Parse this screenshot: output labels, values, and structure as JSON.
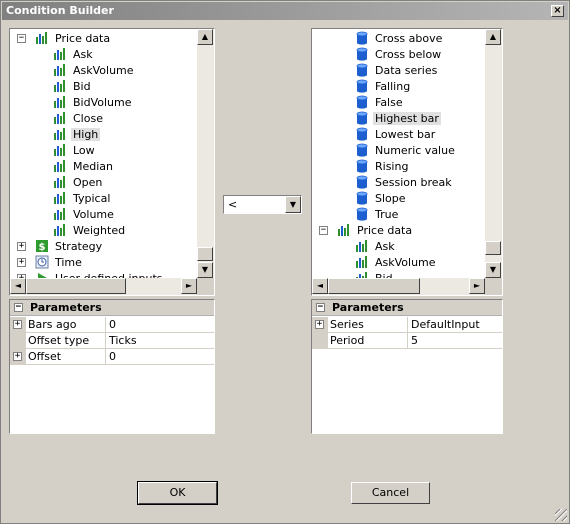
{
  "window": {
    "title": "Condition Builder",
    "close_glyph": "×"
  },
  "left_tree": {
    "items": [
      {
        "label": "Price data",
        "icon": "chart-icon",
        "expander": "−",
        "level": 0
      },
      {
        "label": "Ask",
        "icon": "chart-icon",
        "level": 1
      },
      {
        "label": "AskVolume",
        "icon": "chart-icon",
        "level": 1
      },
      {
        "label": "Bid",
        "icon": "chart-icon",
        "level": 1
      },
      {
        "label": "BidVolume",
        "icon": "chart-icon",
        "level": 1
      },
      {
        "label": "Close",
        "icon": "chart-icon",
        "level": 1
      },
      {
        "label": "High",
        "icon": "chart-icon",
        "level": 1,
        "selected": true
      },
      {
        "label": "Low",
        "icon": "chart-icon",
        "level": 1
      },
      {
        "label": "Median",
        "icon": "chart-icon",
        "level": 1
      },
      {
        "label": "Open",
        "icon": "chart-icon",
        "level": 1
      },
      {
        "label": "Typical",
        "icon": "chart-icon",
        "level": 1
      },
      {
        "label": "Volume",
        "icon": "chart-icon",
        "level": 1
      },
      {
        "label": "Weighted",
        "icon": "chart-icon",
        "level": 1
      },
      {
        "label": "Strategy",
        "icon": "dollar-icon",
        "expander": "+",
        "level": 0
      },
      {
        "label": "Time",
        "icon": "clock-icon",
        "expander": "+",
        "level": 0
      },
      {
        "label": "User defined inputs",
        "icon": "play-icon",
        "expander": "+",
        "level": 0
      }
    ]
  },
  "right_tree": {
    "items": [
      {
        "label": "Cross above",
        "icon": "cylinder-icon",
        "level": 1
      },
      {
        "label": "Cross below",
        "icon": "cylinder-icon",
        "level": 1
      },
      {
        "label": "Data series",
        "icon": "cylinder-icon",
        "level": 1
      },
      {
        "label": "Falling",
        "icon": "cylinder-icon",
        "level": 1
      },
      {
        "label": "False",
        "icon": "cylinder-icon",
        "level": 1
      },
      {
        "label": "Highest bar",
        "icon": "cylinder-icon",
        "level": 1,
        "selected": true
      },
      {
        "label": "Lowest bar",
        "icon": "cylinder-icon",
        "level": 1
      },
      {
        "label": "Numeric value",
        "icon": "cylinder-icon",
        "level": 1
      },
      {
        "label": "Rising",
        "icon": "cylinder-icon",
        "level": 1
      },
      {
        "label": "Session break",
        "icon": "cylinder-icon",
        "level": 1
      },
      {
        "label": "Slope",
        "icon": "cylinder-icon",
        "level": 1
      },
      {
        "label": "True",
        "icon": "cylinder-icon",
        "level": 1
      },
      {
        "label": "Price data",
        "icon": "chart-icon",
        "expander": "−",
        "level": 0
      },
      {
        "label": "Ask",
        "icon": "chart-icon",
        "level": 1
      },
      {
        "label": "AskVolume",
        "icon": "chart-icon",
        "level": 1
      },
      {
        "label": "Bid",
        "icon": "chart-icon",
        "level": 1
      }
    ]
  },
  "operator": {
    "value": "<"
  },
  "left_params": {
    "header": "Parameters",
    "rows": [
      {
        "name": "Bars ago",
        "value": "0",
        "expander": "+"
      },
      {
        "name": "Offset type",
        "value": "Ticks",
        "expander": ""
      },
      {
        "name": "Offset",
        "value": "0",
        "expander": "+"
      }
    ]
  },
  "right_params": {
    "header": "Parameters",
    "rows": [
      {
        "name": "Series",
        "value": "DefaultInput",
        "expander": "+"
      },
      {
        "name": "Period",
        "value": "5",
        "expander": ""
      }
    ]
  },
  "buttons": {
    "ok_label": "OK",
    "cancel_label": "Cancel"
  },
  "scroll_glyphs": {
    "up": "▲",
    "down": "▼",
    "left": "◄",
    "right": "►",
    "drop": "▼"
  },
  "colors": {
    "titlebar": "#808080",
    "face": "#d4d0c8",
    "icon_green": "#2f8f2f",
    "icon_blue": "#1e5fd0"
  }
}
